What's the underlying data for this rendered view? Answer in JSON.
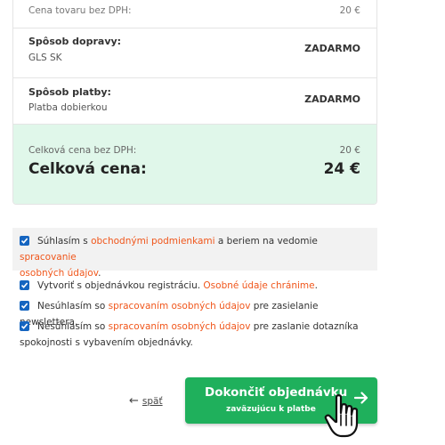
{
  "summary": {
    "price_label": "Cena tovaru bez DPH:",
    "price_value": "20 €",
    "shipping_label": "Spôsob dopravy:",
    "shipping_method": "GLS SK",
    "shipping_value": "ZADARMO",
    "payment_label": "Spôsob platby:",
    "payment_method": "Platba dobierkou",
    "payment_value": "ZADARMO",
    "total_net_label": "Celková cena bez DPH:",
    "total_net_value": "20 €",
    "total_label": "Celková cena:",
    "total_value": "24 €"
  },
  "consents": {
    "terms": {
      "pre": "Súhlasím s ",
      "link1": "obchodnými podmienkami",
      "mid": " a beriem na vedomie ",
      "link2a": "spracovanie",
      "link2b": "osobných údajov",
      "post": "."
    },
    "registration": {
      "pre": "Vytvoriť s objednávkou registráciu. ",
      "link": "Osobné údaje chránime",
      "post": "."
    },
    "newsletter": {
      "pre": "Nesúhlasím so ",
      "link": "spracovaním osobných údajov",
      "post": " pre zasielanie newslettera."
    },
    "survey": {
      "pre": "Nesúhlasím so ",
      "link": "spracovaním osobných údajov",
      "post": " pre zaslanie dotazníka",
      "line2": "spokojnosti s vybavením objednávky."
    }
  },
  "actions": {
    "back_label": "späť",
    "finish_label": "Dokončiť objednávku",
    "finish_sub": "zaväzujúcu k platbe"
  },
  "colors": {
    "accent": "#1fb05c",
    "link": "#f0561b",
    "checkbox": "#1565c0",
    "total_bg": "#e0f7ea"
  }
}
